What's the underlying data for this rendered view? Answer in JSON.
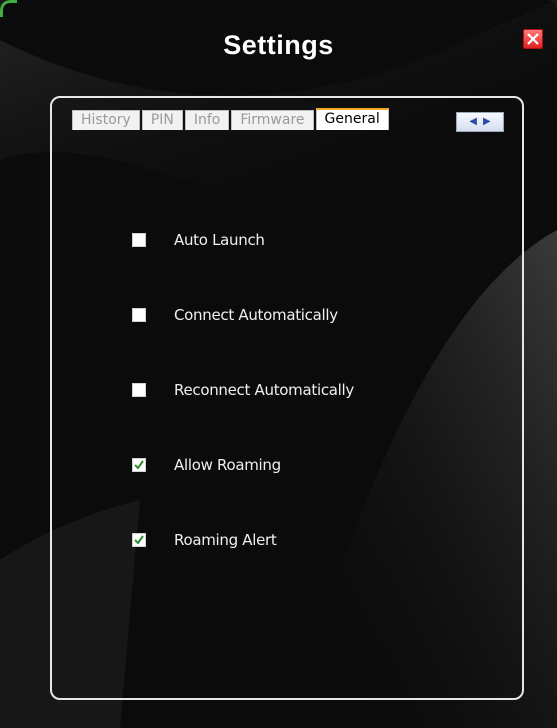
{
  "window": {
    "title": "Settings"
  },
  "tabs": [
    {
      "label": "History",
      "active": false
    },
    {
      "label": "PIN",
      "active": false
    },
    {
      "label": "Info",
      "active": false
    },
    {
      "label": "Firmware",
      "active": false
    },
    {
      "label": "General",
      "active": true
    }
  ],
  "tab_scroll": {
    "left_icon": "arrow-left-icon",
    "right_icon": "arrow-right-icon"
  },
  "options": [
    {
      "label": "Auto Launch",
      "checked": false
    },
    {
      "label": "Connect Automatically",
      "checked": false
    },
    {
      "label": "Reconnect Automatically",
      "checked": false
    },
    {
      "label": "Allow Roaming",
      "checked": true
    },
    {
      "label": "Roaming Alert",
      "checked": true
    }
  ],
  "colors": {
    "background": "#0b0b0b",
    "active_tab_accent": "#f5a623",
    "close_button": "#e02020",
    "check_mark": "#2e8b2e"
  }
}
